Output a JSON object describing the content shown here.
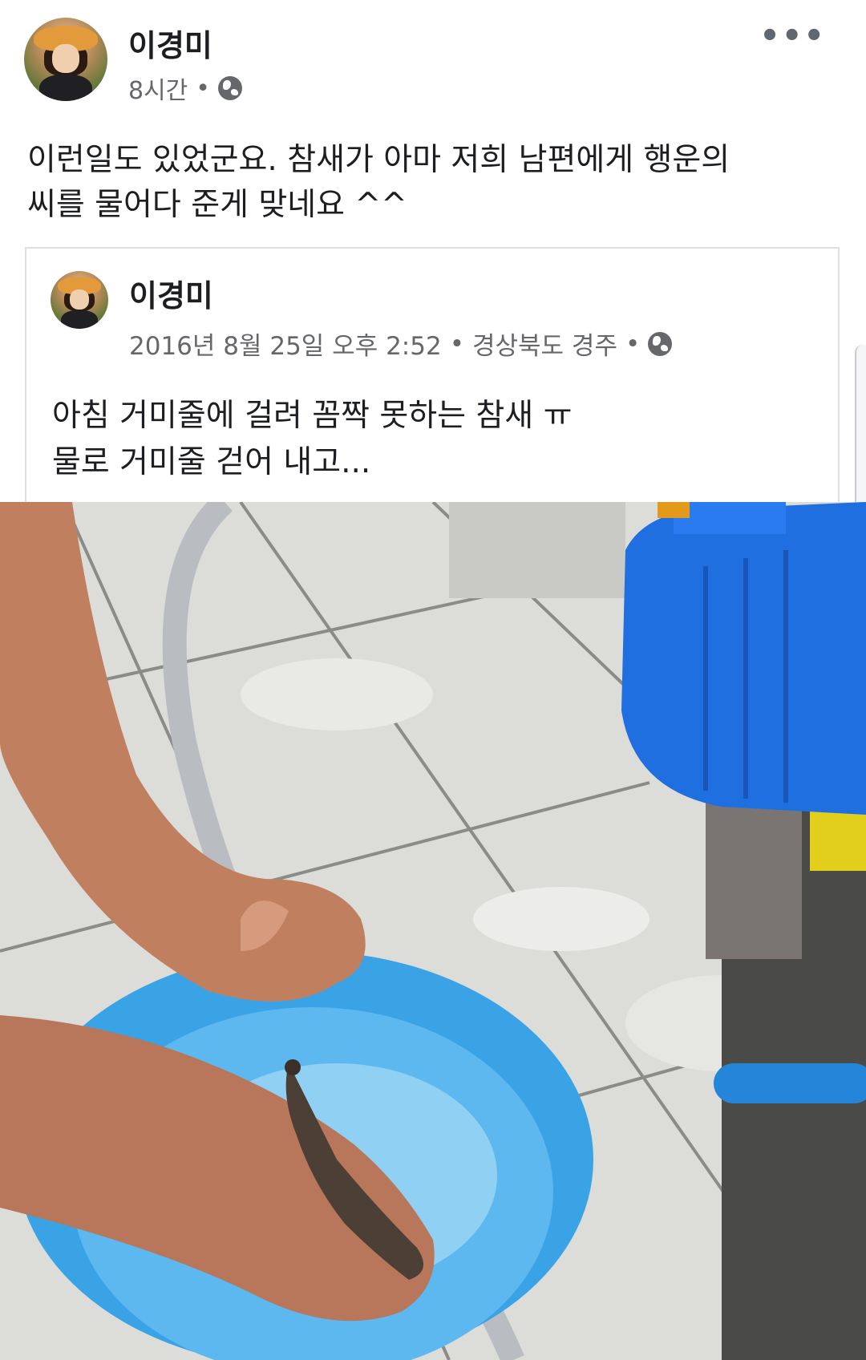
{
  "post": {
    "author": "이경미",
    "time": "8시간",
    "separator": "•",
    "privacy_icon": "globe-icon",
    "more_icon": "more-options-icon",
    "more_glyph": "•••",
    "text_lines": [
      "이런일도 있었군요.  참새가 아마 저희 남편에게 행운의",
      "씨를 물어다 준게 맞네요 ^^"
    ]
  },
  "shared_post": {
    "author": "이경미",
    "date": "2016년 8월 25일 오후 2:52",
    "separator": "•",
    "location": "경상북도 경주",
    "privacy_icon": "globe-icon",
    "text_lines": [
      "아침 거미줄에 걸려 꼼짝 못하는 참새 ㅠ",
      "물로 거미줄 걷어 내고..."
    ]
  },
  "photo": {
    "subject": "hands-holding-sparrow-over-blue-basin"
  }
}
